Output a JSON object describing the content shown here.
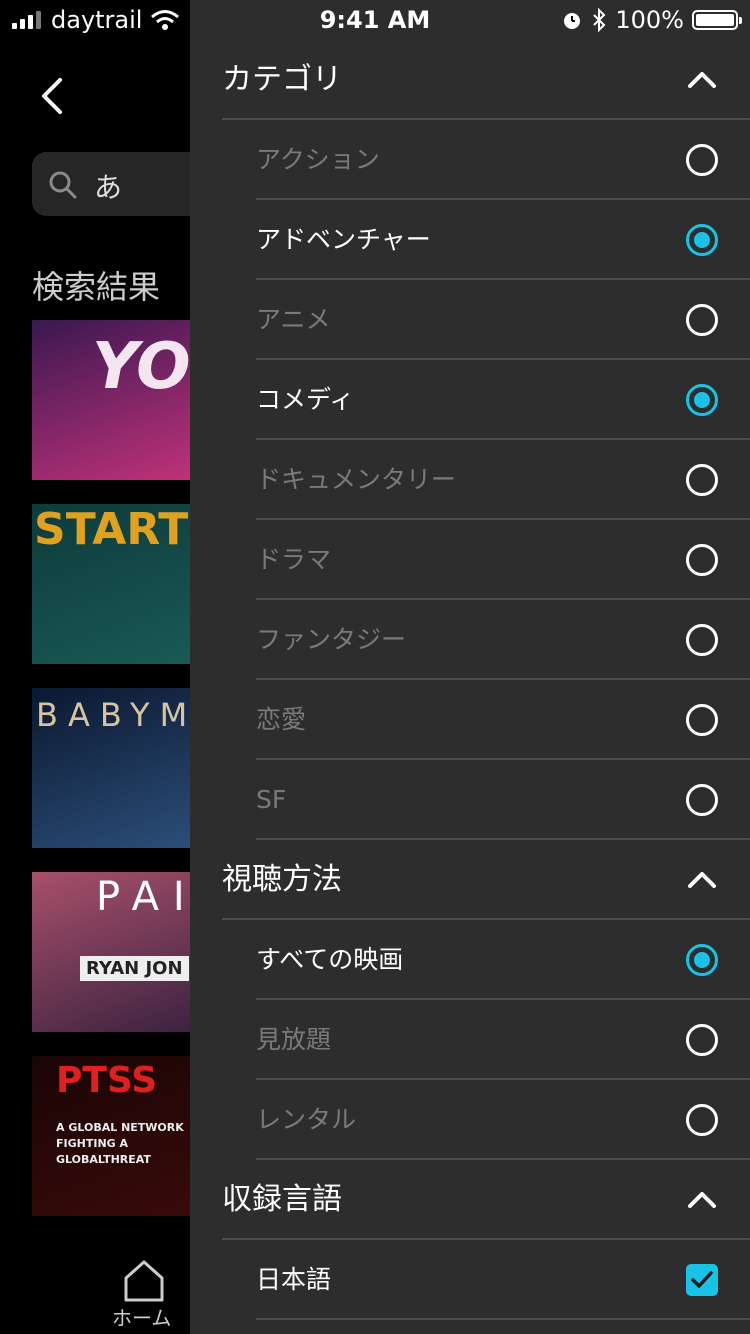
{
  "status_bar": {
    "carrier": "daytrail",
    "time": "9:41 AM",
    "battery": "100%"
  },
  "background_page": {
    "search_query": "あ",
    "results_title": "検索結果",
    "posters": [
      {
        "text": "YO",
        "colors": [
          "#3a1850",
          "#c2327a"
        ]
      },
      {
        "text": "START",
        "colors": [
          "#0d3b3b",
          "#1a5a55"
        ]
      },
      {
        "text": "BABYM",
        "colors": [
          "#0b1830",
          "#2c4f7a"
        ]
      },
      {
        "text": "PAI",
        "subtext": "RYAN JON",
        "colors": [
          "#a8506a",
          "#3a2240"
        ]
      },
      {
        "text": "PTSS",
        "subtext": "A GLOBAL NETWORK FIGHTING A GLOBALTHREAT",
        "colors": [
          "#1a0505",
          "#3a0a0a"
        ]
      }
    ],
    "tab_home_label": "ホーム"
  },
  "filter_panel": {
    "sections": [
      {
        "title": "カテゴリ",
        "type": "radio",
        "options": [
          {
            "label": "アクション",
            "selected": false
          },
          {
            "label": "アドベンチャー",
            "selected": true
          },
          {
            "label": "アニメ",
            "selected": false
          },
          {
            "label": "コメディ",
            "selected": true
          },
          {
            "label": "ドキュメンタリー",
            "selected": false
          },
          {
            "label": "ドラマ",
            "selected": false
          },
          {
            "label": "ファンタジー",
            "selected": false
          },
          {
            "label": "恋愛",
            "selected": false
          },
          {
            "label": "SF",
            "selected": false
          }
        ]
      },
      {
        "title": "視聴方法",
        "type": "radio",
        "options": [
          {
            "label": "すべての映画",
            "selected": true
          },
          {
            "label": "見放題",
            "selected": false
          },
          {
            "label": "レンタル",
            "selected": false
          }
        ]
      },
      {
        "title": "収録言語",
        "type": "checkbox",
        "options": [
          {
            "label": "日本語",
            "selected": true
          }
        ]
      }
    ]
  },
  "colors": {
    "accent": "#19c3e6",
    "panel_bg": "#2d2d2d",
    "divider": "#4c4c4c",
    "inactive_text": "#7a7a7a"
  }
}
